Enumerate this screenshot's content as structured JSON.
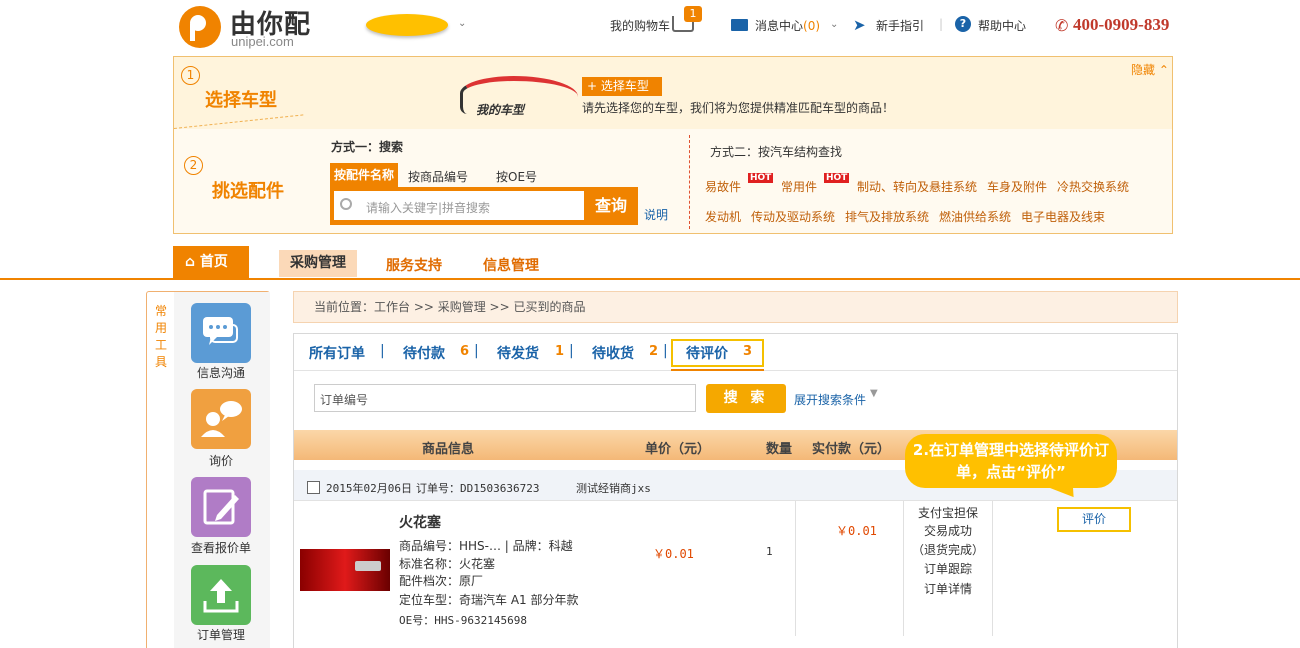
{
  "header": {
    "logo_text": "由你配",
    "logo_sub": "unipei.com",
    "cart_label": "我的购物车",
    "cart_count": "1",
    "messages_label": "消息中心",
    "messages_count": "(0)",
    "guide_label": "新手指引",
    "help_label": "帮助中心",
    "phone": "400-0909-839"
  },
  "car_panel": {
    "step1_num": "1",
    "step1_title": "选择车型",
    "hide_label": "隐藏",
    "car_label": "我的车型",
    "choose_button": "+ 选择车型",
    "choose_desc": "请先选择您的车型，我们将为您提供精准匹配车型的商品！",
    "step2_num": "2",
    "step2_title": "挑选配件",
    "method1_title": "方式一：搜索",
    "search_tabs": [
      "按配件名称",
      "按商品编号",
      "按OE号"
    ],
    "search_placeholder": "请输入关键字|拼音搜索",
    "query_button": "查询",
    "explain_link": "说明",
    "method2_title": "方式二：按汽车结构查找",
    "categories_row1": [
      "易故件",
      "常用件",
      "制动、转向及悬挂系统",
      "车身及附件",
      "冷热交换系统"
    ],
    "hot_badge": "HOT",
    "categories_row2": [
      "发动机",
      "传动及驱动系统",
      "排气及排放系统",
      "燃油供给系统",
      "电子电器及线束"
    ]
  },
  "nav": {
    "home": "首页",
    "items": [
      "采购管理",
      "服务支持",
      "信息管理"
    ]
  },
  "tools": {
    "title": "常用工具",
    "items": [
      {
        "label": "信息沟通",
        "color": "#5b9bd5"
      },
      {
        "label": "询价",
        "color": "#f0a040"
      },
      {
        "label": "查看报价单",
        "color": "#b07cc6"
      },
      {
        "label": "订单管理",
        "color": "#5cb85c"
      }
    ]
  },
  "breadcrumb": "当前位置：工作台 >> 采购管理 >> 已买到的商品",
  "order_tabs": [
    {
      "label": "所有订单",
      "count": ""
    },
    {
      "label": "待付款",
      "count": "6"
    },
    {
      "label": "待发货",
      "count": "1"
    },
    {
      "label": "待收货",
      "count": "2"
    },
    {
      "label": "待评价",
      "count": "3"
    }
  ],
  "search": {
    "order_placeholder": "订单编号",
    "button": "搜 索",
    "expand": "展开搜索条件"
  },
  "table_headers": [
    "商品信息",
    "单价（元）",
    "数量",
    "实付款（元）"
  ],
  "order": {
    "date": "2015年02月06日",
    "order_no_label": "订单号：DD1503636723",
    "seller": "测试经销商jxs",
    "product_name": "火花塞",
    "product_code": "商品编号：HHS-…    |  品牌：科越",
    "standard_name": "标准名称：火花塞",
    "grade": "配件档次：原厂",
    "vehicle": "定位车型：奇瑞汽车 A1 部分年款",
    "oe": "OE号：HHS-9632145698",
    "unit_price": "￥0.01",
    "quantity": "1",
    "paid": "￥0.01",
    "status_lines": [
      "支付宝担保",
      "交易成功",
      "（退货完成）",
      "订单跟踪",
      "订单详情"
    ],
    "eval_button": "评价"
  },
  "callout": "2.在订单管理中选择待评价订单，点击“评价”"
}
